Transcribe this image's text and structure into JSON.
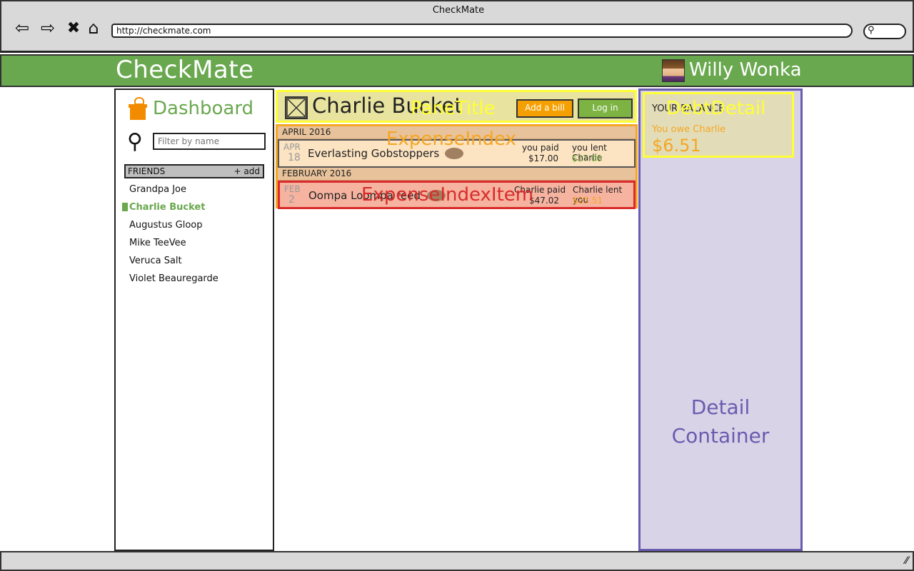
{
  "window": {
    "title": "CheckMate",
    "url": "http://checkmate.com"
  },
  "header": {
    "logo": "CheckMate",
    "user_name": "Willy Wonka"
  },
  "sidebar": {
    "dashboard_label": "Dashboard",
    "filter_placeholder": "Filter by name",
    "friends_header": "FRIENDS",
    "friends_add": "+ add",
    "friends": [
      "Grandpa Joe",
      "Charlie Bucket",
      "Augustus Gloop",
      "Mike TeeVee",
      "Veruca Salt",
      "Violet Beauregarde"
    ],
    "active_friend": "Charlie Bucket"
  },
  "main": {
    "title": "Charlie Bucket",
    "add_bill_label": "Add a bill",
    "login_label": "Log in",
    "overlay_pane_title": "PaneTitle",
    "overlay_expense_index": "ExpenseIndex",
    "overlay_expense_item": "ExpenseIndexItem",
    "groups": [
      {
        "month_header": "APRIL 2016",
        "expense": {
          "month": "APR",
          "day": "18",
          "description": "Everlasting Gobstoppers",
          "paid_label": "you paid",
          "paid_amount": "$17.00",
          "lent_label": "you lent Charlie",
          "lent_amount": "$17.00"
        }
      },
      {
        "month_header": "FEBRUARY 2016",
        "expense": {
          "month": "FEB",
          "day": "2",
          "description": "Oompa Loompa feed",
          "paid_label": "Charlie paid",
          "paid_amount": "$47.02",
          "lent_label": "Charlie lent you",
          "lent_amount": "$23.51"
        }
      }
    ]
  },
  "detail": {
    "balance_label": "YOUR BALANCE",
    "owe_text": "You owe Charlie",
    "owe_amount": "$6.51",
    "overlay_debt_detail": "DebtDetail",
    "container_label": "Detail Container"
  },
  "colors": {
    "brand_green": "#6aa84f",
    "accent_orange": "#f5a623",
    "positive_green": "#7cb342",
    "overlay_yellow": "#ffff33",
    "overlay_red": "#d92b2b",
    "overlay_purple": "#6a5cae"
  }
}
